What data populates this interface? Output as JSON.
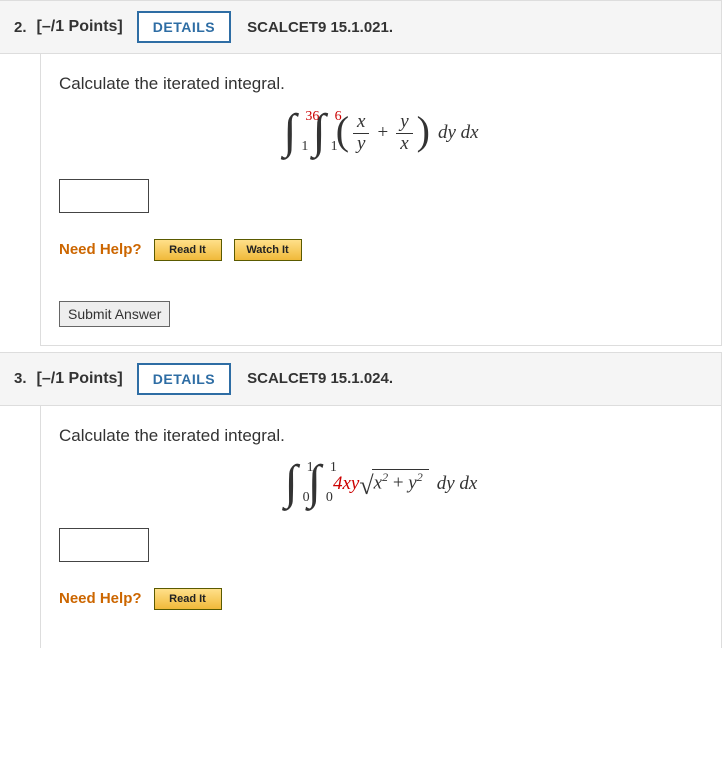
{
  "questions": [
    {
      "number": "2.",
      "points": "[–/1 Points]",
      "details_btn": "DETAILS",
      "reference": "SCALCET9 15.1.021.",
      "prompt": "Calculate the iterated integral.",
      "integral": {
        "outer_upper": "36",
        "outer_lower": "1",
        "inner_upper": "6",
        "inner_lower": "1",
        "frac1_num": "x",
        "frac1_den": "y",
        "plus": "+",
        "frac2_num": "y",
        "frac2_den": "x",
        "diffs": "dy dx"
      },
      "help_label": "Need Help?",
      "read_it": "Read It",
      "watch_it": "Watch It",
      "submit": "Submit Answer"
    },
    {
      "number": "3.",
      "points": "[–/1 Points]",
      "details_btn": "DETAILS",
      "reference": "SCALCET9 15.1.024.",
      "prompt": "Calculate the iterated integral.",
      "integral": {
        "outer_upper": "1",
        "outer_lower": "0",
        "inner_upper": "1",
        "inner_lower": "0",
        "coef": "4xy",
        "rad_x": "x",
        "rad_x_exp": "2",
        "plus": " + ",
        "rad_y": "y",
        "rad_y_exp": "2",
        "diffs": "dy dx"
      },
      "help_label": "Need Help?",
      "read_it": "Read It"
    }
  ]
}
